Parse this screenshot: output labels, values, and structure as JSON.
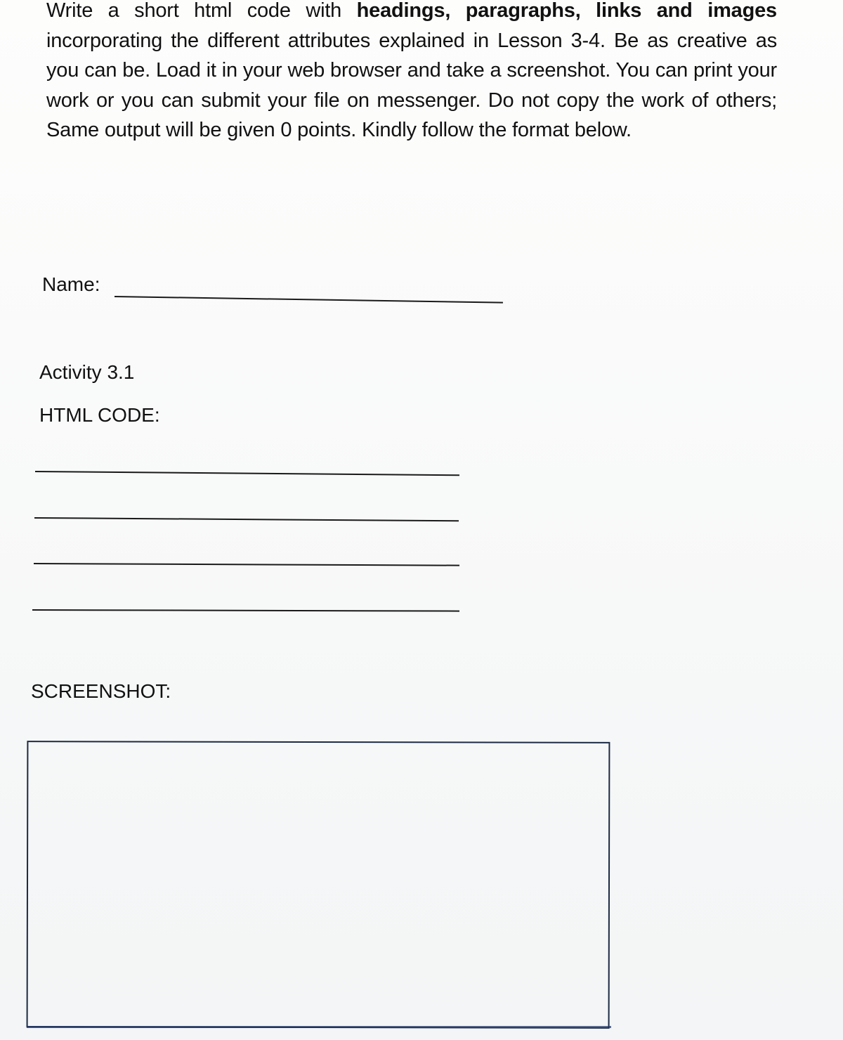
{
  "document": {
    "instructions": {
      "intro": "Write a short html code with ",
      "emphasis": "headings, paragraphs, links and images",
      "rest": " incorporating the different attributes explained in Lesson 3-4. Be as creative as you can be. Load it in your web browser and take a screenshot. You can print your work or you can submit your file on messenger. Do not copy the work of others; Same output will be given 0 points. Kindly follow the format below."
    },
    "name_label": "Name:",
    "activity_label": "Activity 3.1",
    "html_code_label": "HTML CODE:",
    "html_code_line_count": 4,
    "screenshot_label": "SCREENSHOT:"
  },
  "colors": {
    "ink": "#111111",
    "box_border": "#1c2a44",
    "paper": "#fbfbfa"
  }
}
